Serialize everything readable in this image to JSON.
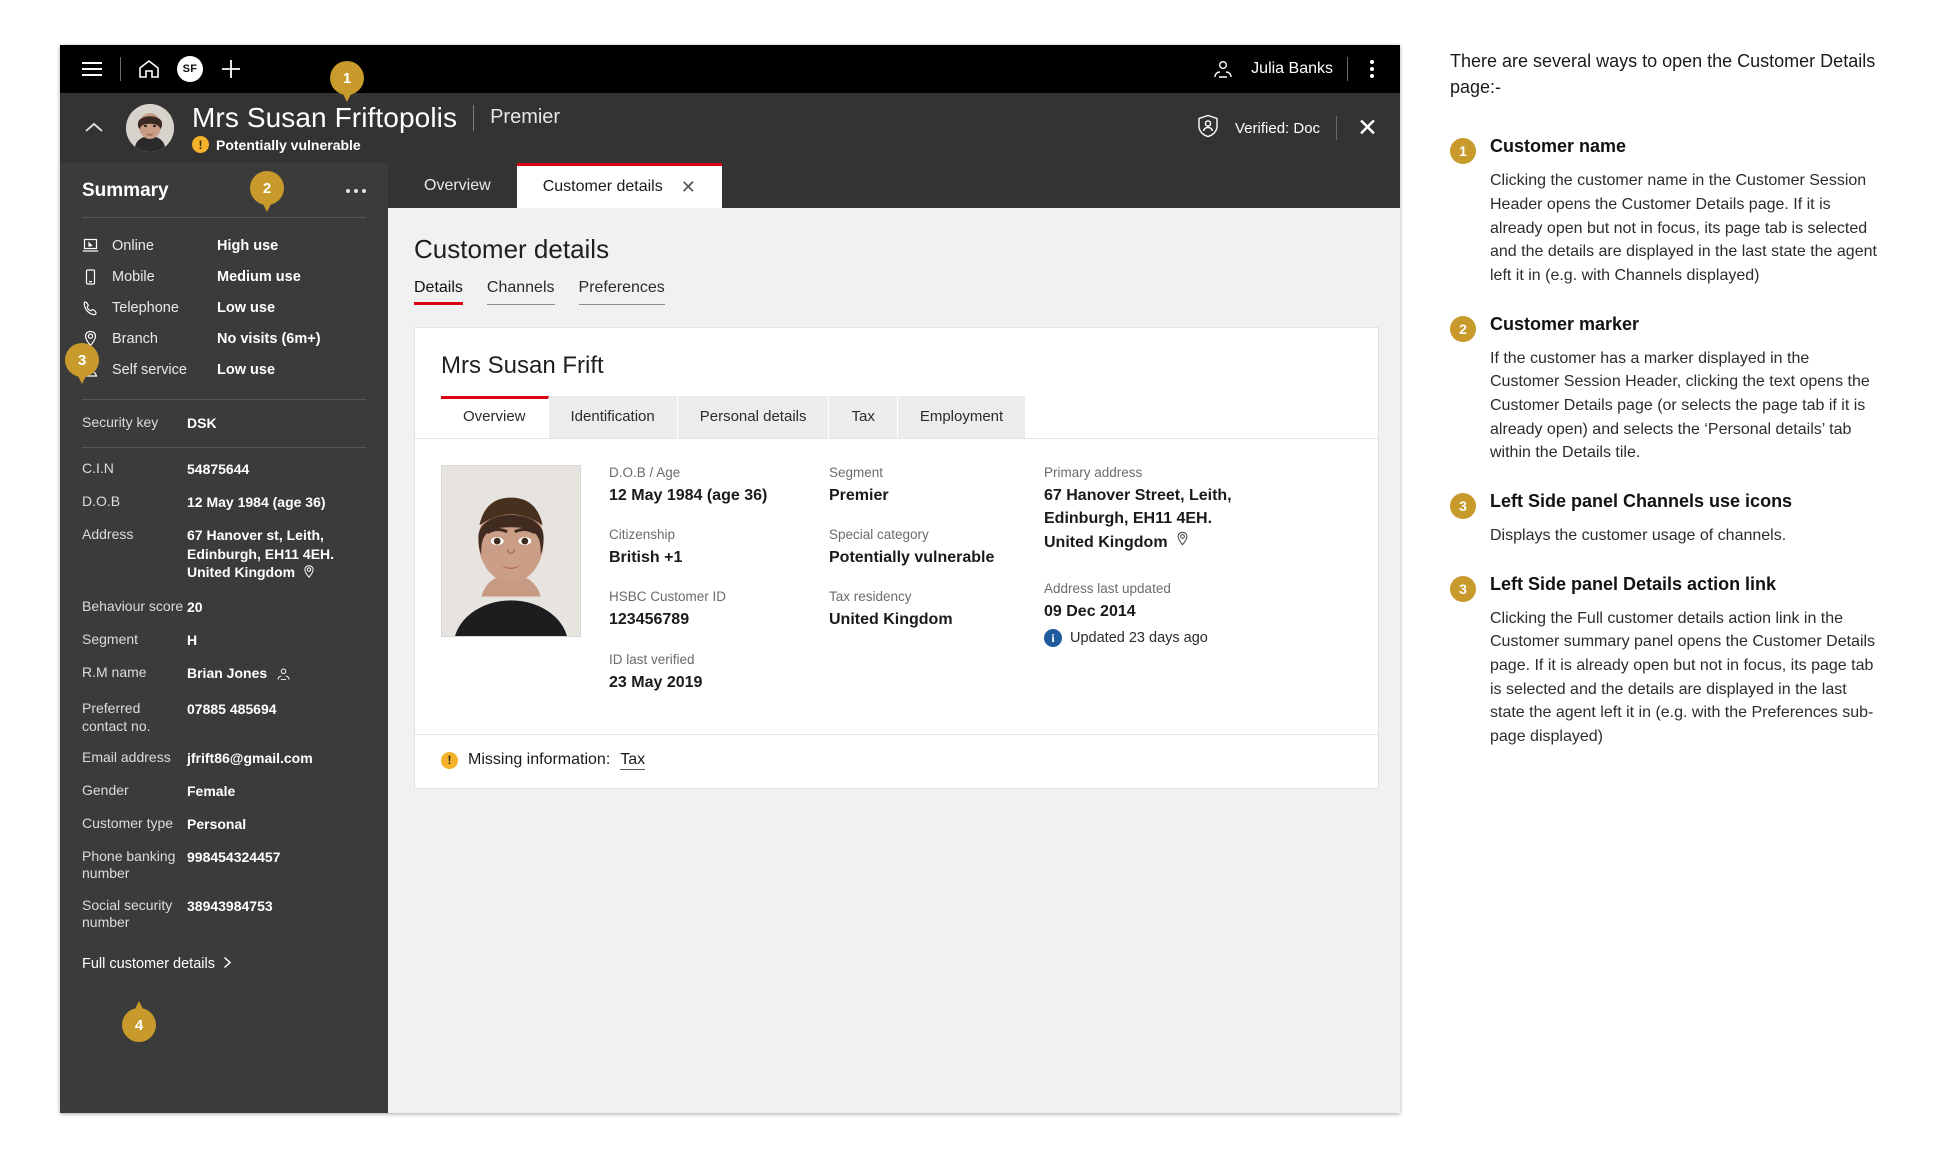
{
  "topbar": {
    "menu_icon": "hamburger-icon",
    "home_icon": "home-icon",
    "profile_initials": "SF",
    "add_icon": "plus-icon",
    "user_name": "Julia Banks",
    "overflow_icon": "kebab-menu-icon"
  },
  "session": {
    "customer_name": "Mrs Susan Friftopolis",
    "segment": "Premier",
    "marker_text": "Potentially vulnerable",
    "verified_label": "Verified: Doc",
    "verified_icon": "shield-person-icon",
    "close_icon": "close-icon",
    "collapse_icon": "chevron-up-icon"
  },
  "sidebar": {
    "title": "Summary",
    "more_icon": "ellipsis-icon",
    "channels": [
      {
        "icon": "laptop-icon",
        "label": "Online",
        "value": "High use"
      },
      {
        "icon": "mobile-icon",
        "label": "Mobile",
        "value": "Medium use"
      },
      {
        "icon": "telephone-icon",
        "label": "Telephone",
        "value": "Low use"
      },
      {
        "icon": "location-pin-icon",
        "label": "Branch",
        "value": "No visits (6m+)"
      },
      {
        "icon": "self-service-icon",
        "label": "Self service",
        "value": "Low use"
      }
    ],
    "security": {
      "label": "Security key",
      "value": "DSK"
    },
    "details": [
      {
        "key": "C.I.N",
        "value": "54875644"
      },
      {
        "key": "D.O.B",
        "value": "12 May 1984  (age 36)"
      },
      {
        "key": "Address",
        "value": "67 Hanover st, Leith, Edinburgh, EH11 4EH. United Kingdom",
        "icon": "location-pin-icon"
      },
      {
        "key": "Behaviour score",
        "value": "20"
      },
      {
        "key": "Segment",
        "value": "H"
      },
      {
        "key": "R.M name",
        "value": "Brian Jones",
        "icon": "person-icon"
      },
      {
        "key": "Preferred contact no.",
        "value": "07885 485694"
      },
      {
        "key": "Email address",
        "value": "jfrift86@gmail.com"
      },
      {
        "key": "Gender",
        "value": "Female"
      },
      {
        "key": "Customer type",
        "value": "Personal"
      },
      {
        "key": "Phone banking number",
        "value": "998454324457"
      },
      {
        "key": "Social security number",
        "value": "38943984753"
      }
    ],
    "action_link": "Full customer details",
    "action_link_icon": "chevron-right-icon"
  },
  "main": {
    "page_tabs": [
      {
        "label": "Overview",
        "active": false,
        "closeable": false
      },
      {
        "label": "Customer details",
        "active": true,
        "closeable": true,
        "close_icon": "close-icon"
      }
    ],
    "page_title": "Customer details",
    "sub_nav": [
      {
        "label": "Details",
        "active": true
      },
      {
        "label": "Channels",
        "active": false
      },
      {
        "label": "Preferences",
        "active": false
      }
    ],
    "card": {
      "name": "Mrs Susan Frift",
      "tabs": [
        {
          "label": "Overview",
          "active": true
        },
        {
          "label": "Identification",
          "active": false
        },
        {
          "label": "Personal details",
          "active": false
        },
        {
          "label": "Tax",
          "active": false
        },
        {
          "label": "Employment",
          "active": false
        }
      ],
      "photo_alt": "customer-photo",
      "col1": [
        {
          "label": "D.O.B / Age",
          "value": "12 May 1984 (age 36)"
        },
        {
          "label": "Citizenship",
          "value": "British +1"
        },
        {
          "label": "HSBC Customer ID",
          "value": "123456789"
        },
        {
          "label": "ID last verified",
          "value": "23 May 2019"
        }
      ],
      "col2": [
        {
          "label": "Segment",
          "value": "Premier"
        },
        {
          "label": "Special category",
          "value": "Potentially vulnerable"
        },
        {
          "label": "Tax residency",
          "value": "United Kingdom"
        }
      ],
      "col3": {
        "address_label": "Primary address",
        "address_lines": [
          "67 Hanover Street, Leith,",
          "Edinburgh, EH11 4EH.",
          "United Kingdom"
        ],
        "address_icon": "location-pin-icon",
        "updated_label": "Address last updated",
        "updated_value": "09 Dec 2014",
        "updated_note": "Updated 23 days ago",
        "info_icon": "info-icon"
      },
      "footer": {
        "warn_icon": "warning-icon",
        "label": "Missing information:",
        "link": "Tax"
      }
    }
  },
  "pins": [
    {
      "number": "1"
    },
    {
      "number": "2"
    },
    {
      "number": "3"
    },
    {
      "number": "4"
    }
  ],
  "notes": {
    "intro": "There are several ways to open the Customer Details page:-",
    "items": [
      {
        "badge": "1",
        "title": "Customer name",
        "body": "Clicking the customer name in the Customer Session Header opens the Customer Details page. If it is already open but not in focus, its page tab is selected and the details are displayed in the last state the agent left it in (e.g. with Channels displayed)"
      },
      {
        "badge": "2",
        "title": "Customer marker",
        "body": "If the customer has a marker displayed in the Customer Session Header, clicking the text opens the Customer Details page (or selects the page tab if it is already open) and selects the ‘Personal details’ tab within the Details tile."
      },
      {
        "badge": "3",
        "title": "Left Side panel Channels use icons",
        "body": "Displays the customer usage of channels."
      },
      {
        "badge": "3",
        "title": "Left Side panel Details action link",
        "body": "Clicking the Full customer details action link in the Customer summary panel opens the Customer Details page. If it is already open but not in focus, its page tab is selected and the details are displayed in the last state the agent left it in (e.g. with the Preferences sub-page displayed)"
      }
    ]
  },
  "colors": {
    "accent_red": "#db0011",
    "pin_gold": "#c79a2b",
    "warn_amber": "#f3b229",
    "info_blue": "#1f5c9e",
    "sidebar_bg": "#3b3b3b",
    "header_bg": "#333333"
  }
}
